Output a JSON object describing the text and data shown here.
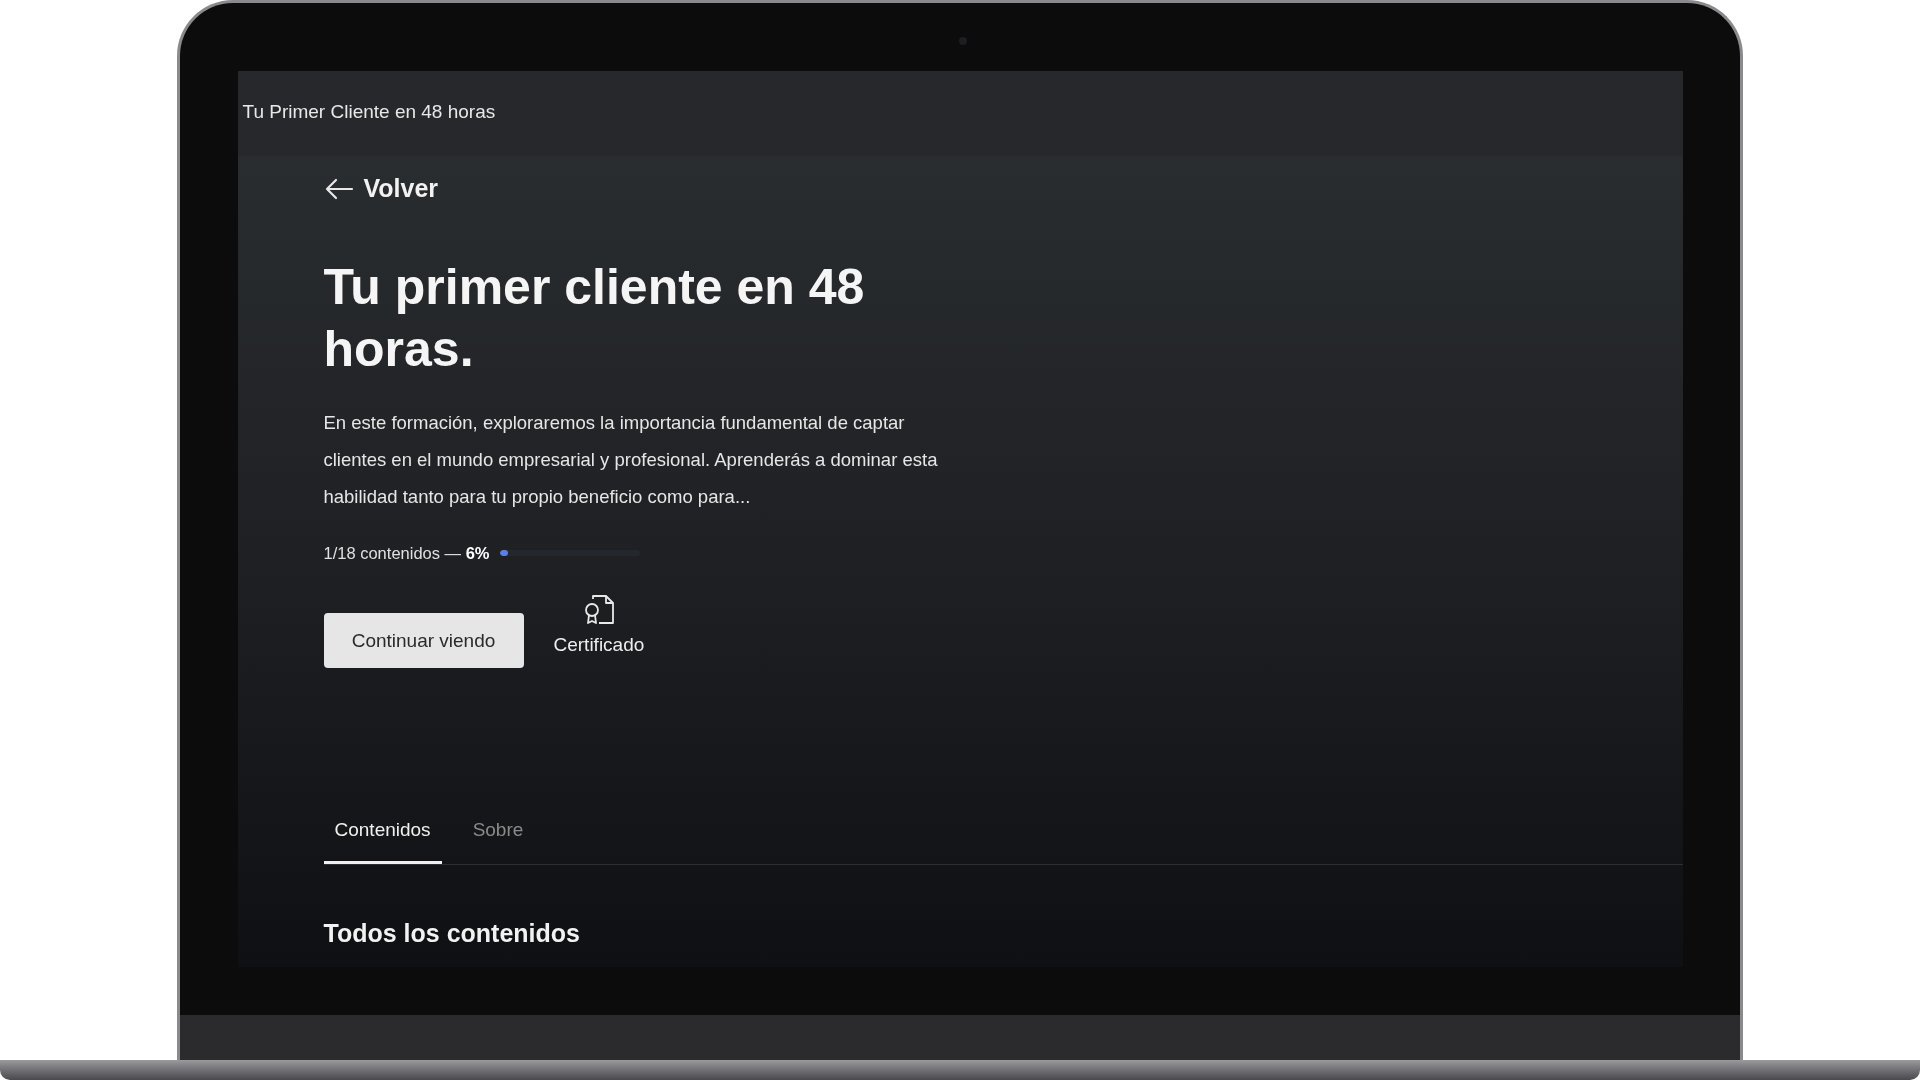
{
  "window": {
    "title": "Tu Primer Cliente en 48 horas"
  },
  "back_link": {
    "label": "Volver"
  },
  "course": {
    "title": "Tu primer cliente en 48 horas.",
    "description": "En este formación, exploraremos la importancia fundamental de captar clientes en el mundo empresarial y profesional. Aprenderás a dominar esta habilidad tanto para tu propio beneficio como para...",
    "progress_text": "1/18 contenidos —",
    "progress_percent": "6%",
    "progress": {
      "level": 0.06
    }
  },
  "actions": {
    "primary": "Continuar viendo",
    "certificate": "Certificado"
  },
  "tabs": [
    {
      "label": "Contenidos",
      "selected": true
    },
    {
      "label": "Sobre",
      "selected": false
    }
  ],
  "section_title": "Todos los contenidos"
}
